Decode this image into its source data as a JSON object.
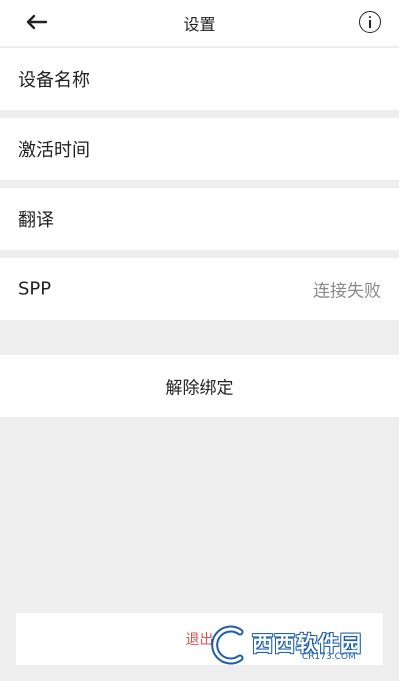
{
  "header": {
    "title": "设置",
    "back_icon": "arrow-left-icon",
    "info_icon": "info-circle-icon"
  },
  "settings": {
    "items": [
      {
        "label": "设备名称",
        "value": ""
      },
      {
        "label": "激活时间",
        "value": ""
      },
      {
        "label": "翻译",
        "value": ""
      },
      {
        "label": "SPP",
        "value": "连接失败"
      }
    ]
  },
  "actions": {
    "unbind_label": "解除绑定",
    "logout_label": "退出"
  },
  "watermark": {
    "brand": "西西软件园",
    "domain": "CR173.COM"
  },
  "colors": {
    "background": "#eeeeee",
    "surface": "#ffffff",
    "text": "#222222",
    "secondary_text": "#8a8a8a",
    "logout_text": "#d9534f",
    "watermark_blue": "#1c5fa8"
  }
}
